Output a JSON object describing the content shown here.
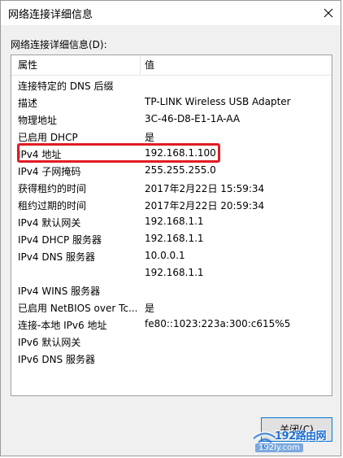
{
  "window": {
    "title": "网络连接详细信息"
  },
  "section_label": "网络连接详细信息(D):",
  "columns": {
    "property": "属性",
    "value": "值"
  },
  "rows": [
    {
      "property": "连接特定的 DNS 后缀",
      "value": ""
    },
    {
      "property": "描述",
      "value": "TP-LINK Wireless USB Adapter"
    },
    {
      "property": "物理地址",
      "value": "3C-46-D8-E1-1A-AA"
    },
    {
      "property": "已启用 DHCP",
      "value": "是"
    },
    {
      "property": "IPv4 地址",
      "value": "192.168.1.100"
    },
    {
      "property": "IPv4 子网掩码",
      "value": "255.255.255.0"
    },
    {
      "property": "获得租约的时间",
      "value": "2017年2月22日 15:59:34"
    },
    {
      "property": "租约过期的时间",
      "value": "2017年2月22日 20:59:34"
    },
    {
      "property": "IPv4 默认网关",
      "value": "192.168.1.1"
    },
    {
      "property": "IPv4 DHCP 服务器",
      "value": "192.168.1.1"
    },
    {
      "property": "IPv4 DNS 服务器",
      "value": "10.0.0.1"
    },
    {
      "property": "",
      "value": "192.168.1.1"
    },
    {
      "property": "IPv4 WINS 服务器",
      "value": ""
    },
    {
      "property": "已启用 NetBIOS over Tc...",
      "value": "是"
    },
    {
      "property": "连接-本地 IPv6 地址",
      "value": "fe80::1023:223a:300:c615%5"
    },
    {
      "property": "IPv6 默认网关",
      "value": ""
    },
    {
      "property": "IPv6 DNS 服务器",
      "value": ""
    }
  ],
  "close_button": {
    "label": "关闭(C)"
  },
  "watermark": {
    "main": "192路由网",
    "sub": "192ly.com"
  },
  "colors": {
    "highlight": "#e11b22",
    "button_border": "#0078d7",
    "watermark": "#1e6fd0"
  },
  "icons": {
    "close": "close-icon",
    "watermark_logo": "wifi-logo-icon"
  }
}
